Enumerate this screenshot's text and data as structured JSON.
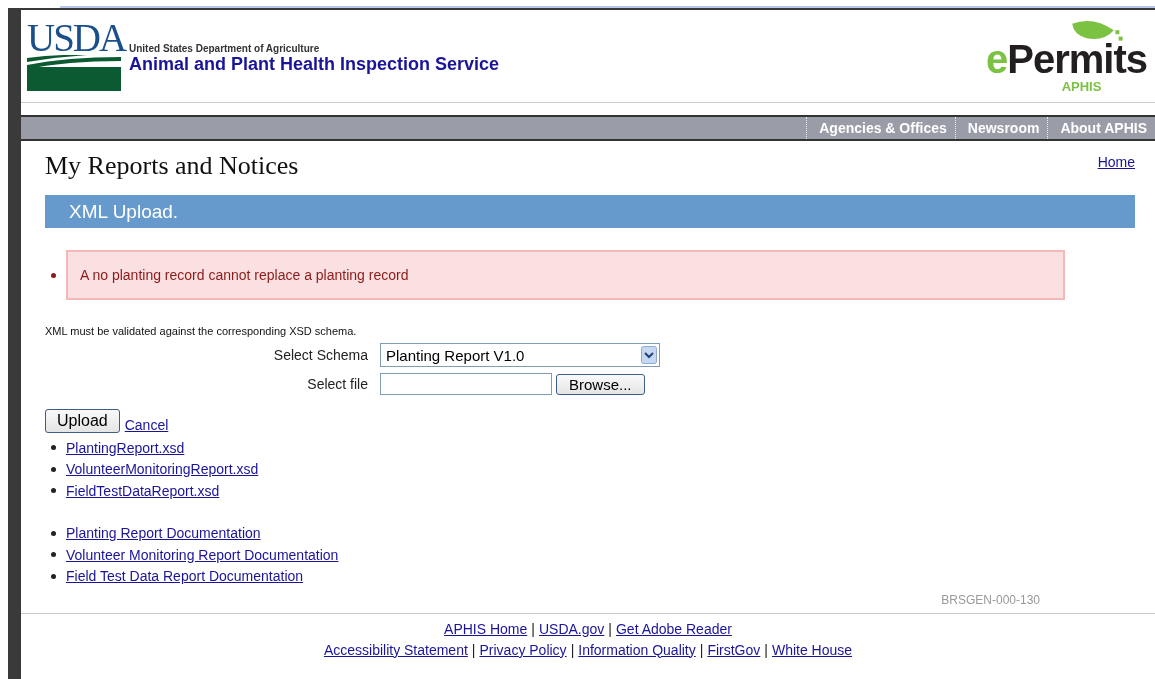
{
  "header": {
    "usda_logo": "USDA",
    "department": "United States Department of Agriculture",
    "agency": "Animal and Plant Health Inspection Service",
    "epermits_logo": {
      "e": "e",
      "rest": "Permits",
      "sub": "APHIS"
    }
  },
  "nav": [
    "Agencies & Offices",
    "Newsroom",
    "About APHIS"
  ],
  "page_title": "My Reports and Notices",
  "home_link": "Home",
  "section_title": "XML Upload.",
  "errors": [
    "A no planting record cannot replace a planting record"
  ],
  "note": "XML must be validated against the corresponding XSD schema.",
  "form": {
    "schema_label": "Select Schema",
    "schema_value": "Planting Report V1.0",
    "file_label": "Select file",
    "browse_button": "Browse..."
  },
  "upload_button": "Upload",
  "cancel_link": "Cancel",
  "schema_links": [
    "PlantingReport.xsd",
    "VolunteerMonitoringReport.xsd",
    "FieldTestDataReport.xsd"
  ],
  "doc_links": [
    "Planting Report Documentation",
    "Volunteer Monitoring Report Documentation",
    "Field Test Data Report Documentation"
  ],
  "page_code": "BRSGEN-000-130",
  "footer": {
    "separator": "|",
    "rows": [
      [
        "APHIS Home",
        "USDA.gov",
        "Get Adobe Reader"
      ],
      [
        "Accessibility Statement",
        "Privacy Policy",
        "Information Quality",
        "FirstGov",
        "White House"
      ]
    ]
  }
}
